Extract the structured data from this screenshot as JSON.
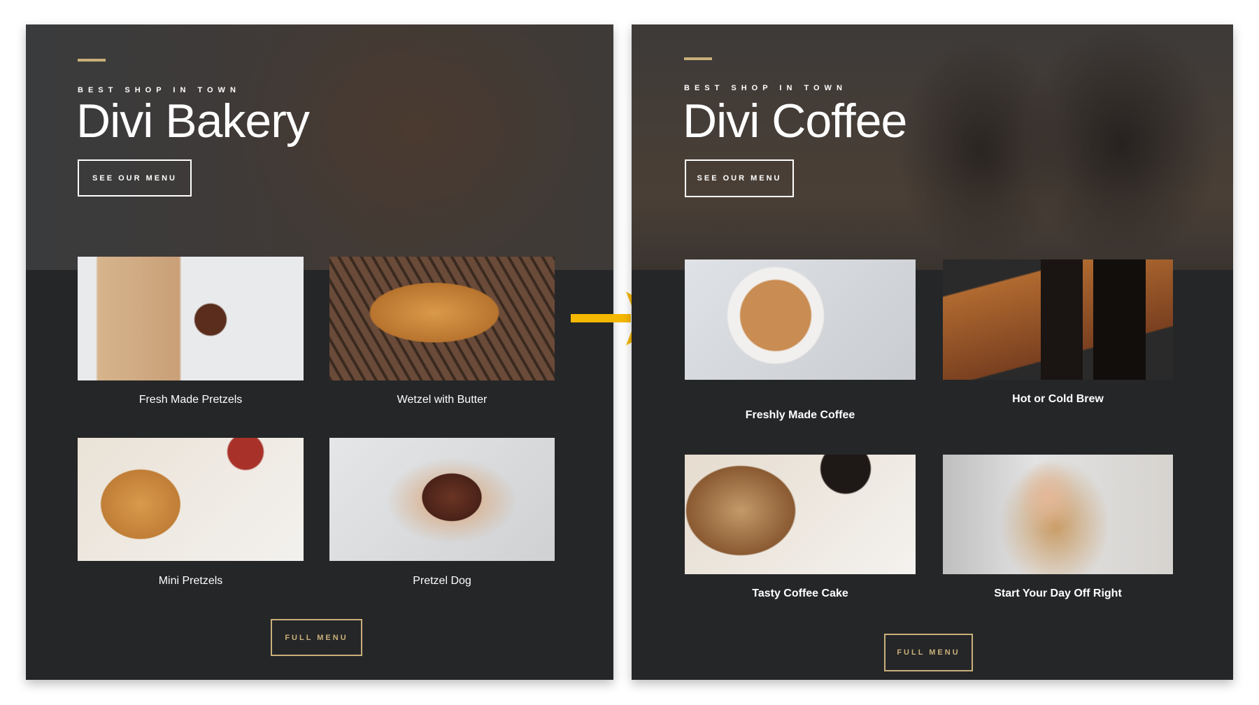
{
  "left": {
    "subtitle": "BEST SHOP IN TOWN",
    "title": "Divi Bakery",
    "hero_button": "SEE OUR MENU",
    "items": [
      {
        "caption": "Fresh Made Pretzels"
      },
      {
        "caption": "Wetzel with Butter"
      },
      {
        "caption": "Mini Pretzels"
      },
      {
        "caption": "Pretzel Dog"
      }
    ],
    "full_menu": "FULL MENU"
  },
  "right": {
    "subtitle": "BEST SHOP IN TOWN",
    "title": "Divi Coffee",
    "hero_button": "SEE OUR MENU",
    "items": [
      {
        "caption": "Freshly Made Coffee"
      },
      {
        "caption": "Hot or Cold Brew"
      },
      {
        "caption": "Tasty Coffee Cake"
      },
      {
        "caption": "Start Your Day Off Right"
      }
    ],
    "full_menu": "FULL MENU"
  },
  "colors": {
    "accent": "#c9b07a",
    "arrow": "#f5b800",
    "panel": "#252628"
  }
}
